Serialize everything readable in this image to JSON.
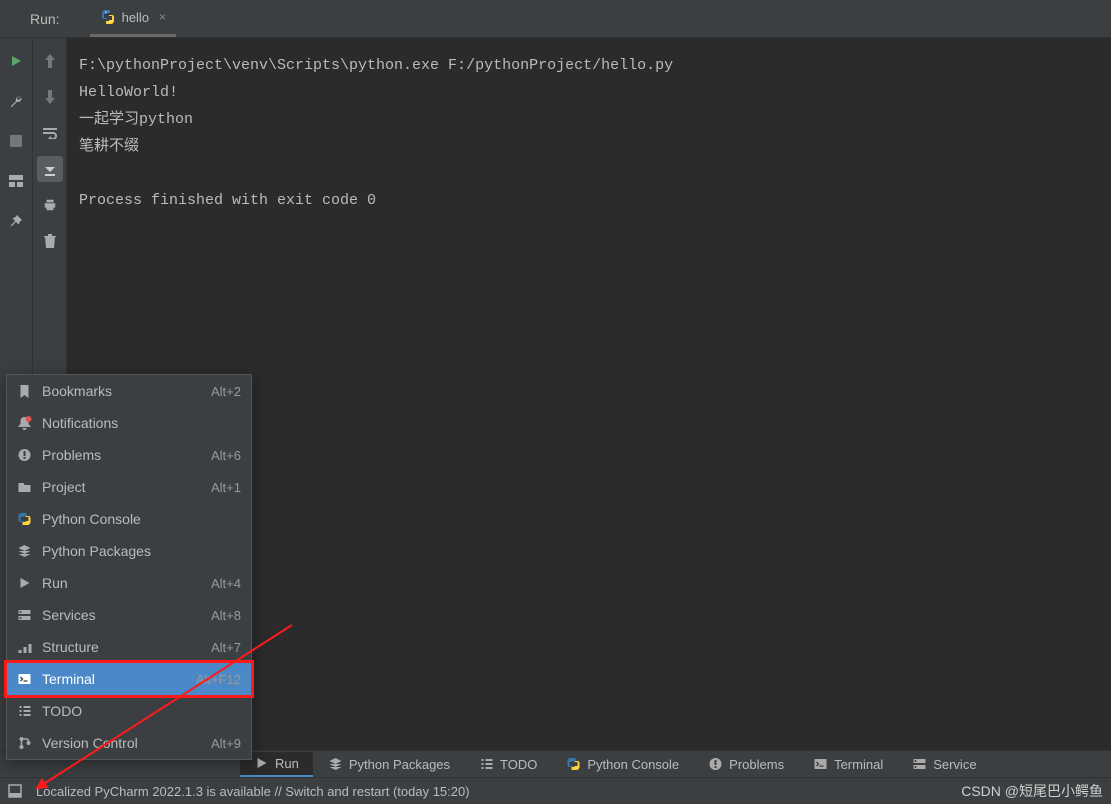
{
  "tabbar": {
    "run_label": "Run:",
    "tab_label": "hello",
    "tab_close": "×"
  },
  "console": {
    "lines": [
      "F:\\pythonProject\\venv\\Scripts\\python.exe F:/pythonProject/hello.py",
      "HelloWorld!",
      "一起学习python",
      "笔耕不缀",
      "",
      "Process finished with exit code 0"
    ]
  },
  "popup": {
    "items": [
      {
        "icon": "bookmark",
        "label": "Bookmarks",
        "shortcut": "Alt+2"
      },
      {
        "icon": "bell",
        "label": "Notifications",
        "shortcut": ""
      },
      {
        "icon": "warning",
        "label": "Problems",
        "shortcut": "Alt+6"
      },
      {
        "icon": "folder",
        "label": "Project",
        "shortcut": "Alt+1"
      },
      {
        "icon": "python",
        "label": "Python Console",
        "shortcut": ""
      },
      {
        "icon": "stack",
        "label": "Python Packages",
        "shortcut": ""
      },
      {
        "icon": "play",
        "label": "Run",
        "shortcut": "Alt+4"
      },
      {
        "icon": "services",
        "label": "Services",
        "shortcut": "Alt+8"
      },
      {
        "icon": "structure",
        "label": "Structure",
        "shortcut": "Alt+7"
      },
      {
        "icon": "terminal",
        "label": "Terminal",
        "shortcut": "Alt+F12",
        "highlighted": true
      },
      {
        "icon": "todo",
        "label": "TODO",
        "shortcut": ""
      },
      {
        "icon": "vcs",
        "label": "Version Control",
        "shortcut": "Alt+9"
      }
    ]
  },
  "toolbar": {
    "items": [
      {
        "icon": "play",
        "label": "Run",
        "active": true
      },
      {
        "icon": "stack",
        "label": "Python Packages"
      },
      {
        "icon": "todo",
        "label": "TODO"
      },
      {
        "icon": "python",
        "label": "Python Console"
      },
      {
        "icon": "warning",
        "label": "Problems"
      },
      {
        "icon": "terminal",
        "label": "Terminal"
      },
      {
        "icon": "services",
        "label": "Service"
      }
    ]
  },
  "statusbar": {
    "message": "Localized PyCharm 2022.1.3 is available // Switch and restart (today 15:20)",
    "watermark": "CSDN @短尾巴小鳄鱼"
  },
  "icons": {
    "play": "▶",
    "wrench": "🔧",
    "stop": "■",
    "layout": "▣",
    "pin": "📌",
    "up": "↑",
    "down": "↓",
    "wrap": "↲",
    "scroll": "⤓",
    "print": "🖶",
    "trash": "🗑"
  }
}
